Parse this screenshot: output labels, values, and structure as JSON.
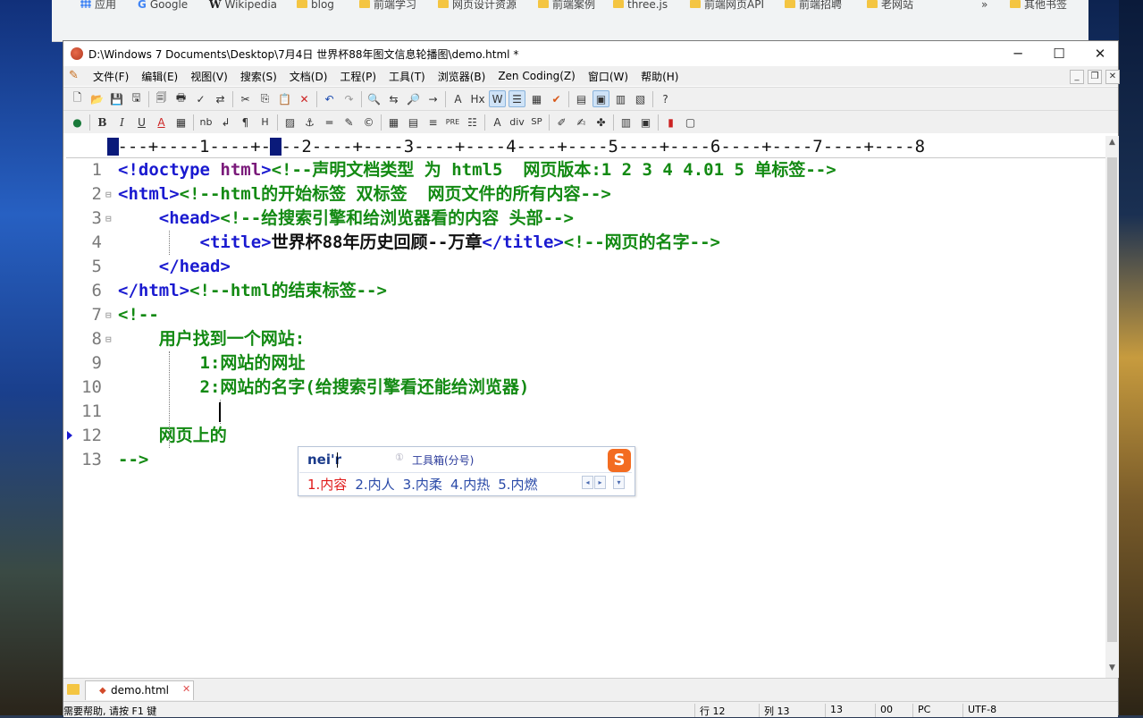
{
  "browser": {
    "bookmarks": [
      {
        "label": "应用",
        "icon": "apps-icon"
      },
      {
        "label": "Google",
        "icon": "google-icon"
      },
      {
        "label": "Wikipedia",
        "icon": "wikipedia-icon"
      },
      {
        "label": "blog",
        "icon": "folder-icon"
      },
      {
        "label": "前端学习",
        "icon": "folder-icon"
      },
      {
        "label": "网页设计资源",
        "icon": "folder-icon"
      },
      {
        "label": "前端案例",
        "icon": "folder-icon"
      },
      {
        "label": "three.js",
        "icon": "folder-icon"
      },
      {
        "label": "前端网页API",
        "icon": "folder-icon"
      },
      {
        "label": "前端招聘",
        "icon": "folder-icon"
      },
      {
        "label": "老网站",
        "icon": "folder-icon"
      }
    ],
    "overflow": "»",
    "other_bookmarks": "其他书签"
  },
  "window": {
    "title": "D:\\Windows 7 Documents\\Desktop\\7月4日 世界杯88年图文信息轮播图\\demo.html *",
    "minimize": "─",
    "maximize": "☐",
    "close": "✕"
  },
  "menu": [
    "文件(F)",
    "编辑(E)",
    "视图(V)",
    "搜索(S)",
    "文档(D)",
    "工程(P)",
    "工具(T)",
    "浏览器(B)",
    "Zen Coding(Z)",
    "窗口(W)",
    "帮助(H)"
  ],
  "ruler": "----+----1----+----2----+----3----+----4----+----5----+----6----+----7----+----8",
  "editor": {
    "lines": [
      {
        "n": "1",
        "fold": false,
        "segments": [
          {
            "t": "<!doctype ",
            "c": "tag"
          },
          {
            "t": "html",
            "c": "attr"
          },
          {
            "t": ">",
            "c": "tag"
          },
          {
            "t": "<!--声明文档类型 为 html5  网页版本:1 2 3 4 4.01 5 单标签-->",
            "c": "cm"
          }
        ]
      },
      {
        "n": "2",
        "fold": true,
        "segments": [
          {
            "t": "<html>",
            "c": "tag"
          },
          {
            "t": "<!--html的开始标签 双标签  网页文件的所有内容-->",
            "c": "cm"
          }
        ]
      },
      {
        "n": "3",
        "fold": true,
        "segments": [
          {
            "t": "    ",
            "c": "txt"
          },
          {
            "t": "<head>",
            "c": "tag"
          },
          {
            "t": "<!--给搜索引擎和给浏览器看的内容 头部-->",
            "c": "cm"
          }
        ]
      },
      {
        "n": "4",
        "fold": false,
        "segments": [
          {
            "t": "        ",
            "c": "txt"
          },
          {
            "t": "<title>",
            "c": "tag"
          },
          {
            "t": "世界杯88年历史回顾--万章",
            "c": "txt"
          },
          {
            "t": "</title>",
            "c": "tag"
          },
          {
            "t": "<!--网页的名字-->",
            "c": "cm"
          }
        ]
      },
      {
        "n": "5",
        "fold": false,
        "segments": [
          {
            "t": "    ",
            "c": "txt"
          },
          {
            "t": "</head>",
            "c": "tag"
          }
        ]
      },
      {
        "n": "6",
        "fold": false,
        "segments": [
          {
            "t": "</html>",
            "c": "tag"
          },
          {
            "t": "<!--html的结束标签-->",
            "c": "cm"
          }
        ]
      },
      {
        "n": "7",
        "fold": true,
        "segments": [
          {
            "t": "<!--",
            "c": "cm"
          }
        ]
      },
      {
        "n": "8",
        "fold": true,
        "segments": [
          {
            "t": "    用户找到一个网站:",
            "c": "cm"
          }
        ]
      },
      {
        "n": "9",
        "fold": false,
        "segments": [
          {
            "t": "        1:网站的网址",
            "c": "cm"
          }
        ]
      },
      {
        "n": "10",
        "fold": false,
        "segments": [
          {
            "t": "        2:网站的名字(给搜索引擎看还能给浏览器)",
            "c": "cm"
          }
        ]
      },
      {
        "n": "11",
        "fold": false,
        "segments": []
      },
      {
        "n": "12",
        "fold": false,
        "segments": [
          {
            "t": "    网页上的",
            "c": "cm"
          }
        ]
      },
      {
        "n": "13",
        "fold": false,
        "segments": [
          {
            "t": "-->",
            "c": "cm"
          }
        ]
      }
    ]
  },
  "ime": {
    "input": "nei'r",
    "hint_num": "①",
    "hint": "工具箱(分号)",
    "logo": "S",
    "candidates": [
      "1.内容",
      "2.内人",
      "3.内柔",
      "4.内热",
      "5.内燃"
    ],
    "prev": "◂",
    "next": "▸",
    "more": "▾"
  },
  "tab": {
    "name": "demo.html",
    "close": "✕",
    "dirty": "◆"
  },
  "status": {
    "help": "需要帮助, 请按 F1 键",
    "line": "行 12",
    "col": "列 13",
    "count": "13",
    "code": "00",
    "mode": "PC",
    "encoding": "UTF-8"
  }
}
